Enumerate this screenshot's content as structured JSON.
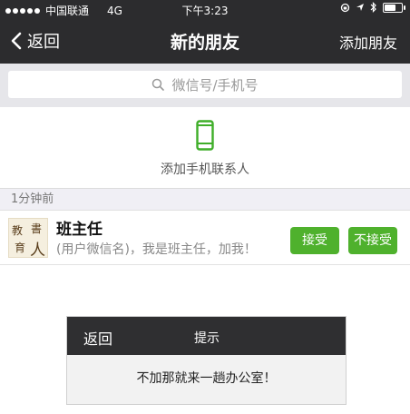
{
  "status": {
    "carrier": "中国联通",
    "network": "4G",
    "time": "下午3:23"
  },
  "nav": {
    "back_label": "返回",
    "title": "新的朋友",
    "add_label": "添加朋友"
  },
  "search": {
    "placeholder": "微信号/手机号"
  },
  "add_contacts": {
    "label": "添加手机联系人",
    "icon": "phone-icon",
    "icon_color": "#3fae29"
  },
  "section": {
    "label": "1分钟前"
  },
  "request": {
    "name": "班主任",
    "message": "(用户微信名)，我是班主任，加我！",
    "avatar_chars": [
      "教",
      "書",
      "育",
      "人"
    ],
    "accept_label": "接受",
    "reject_label": "不接受",
    "button_color": "#4fb12d"
  },
  "dialog": {
    "back_label": "返回",
    "title": "提示",
    "message": "不加那就来一趟办公室！"
  }
}
